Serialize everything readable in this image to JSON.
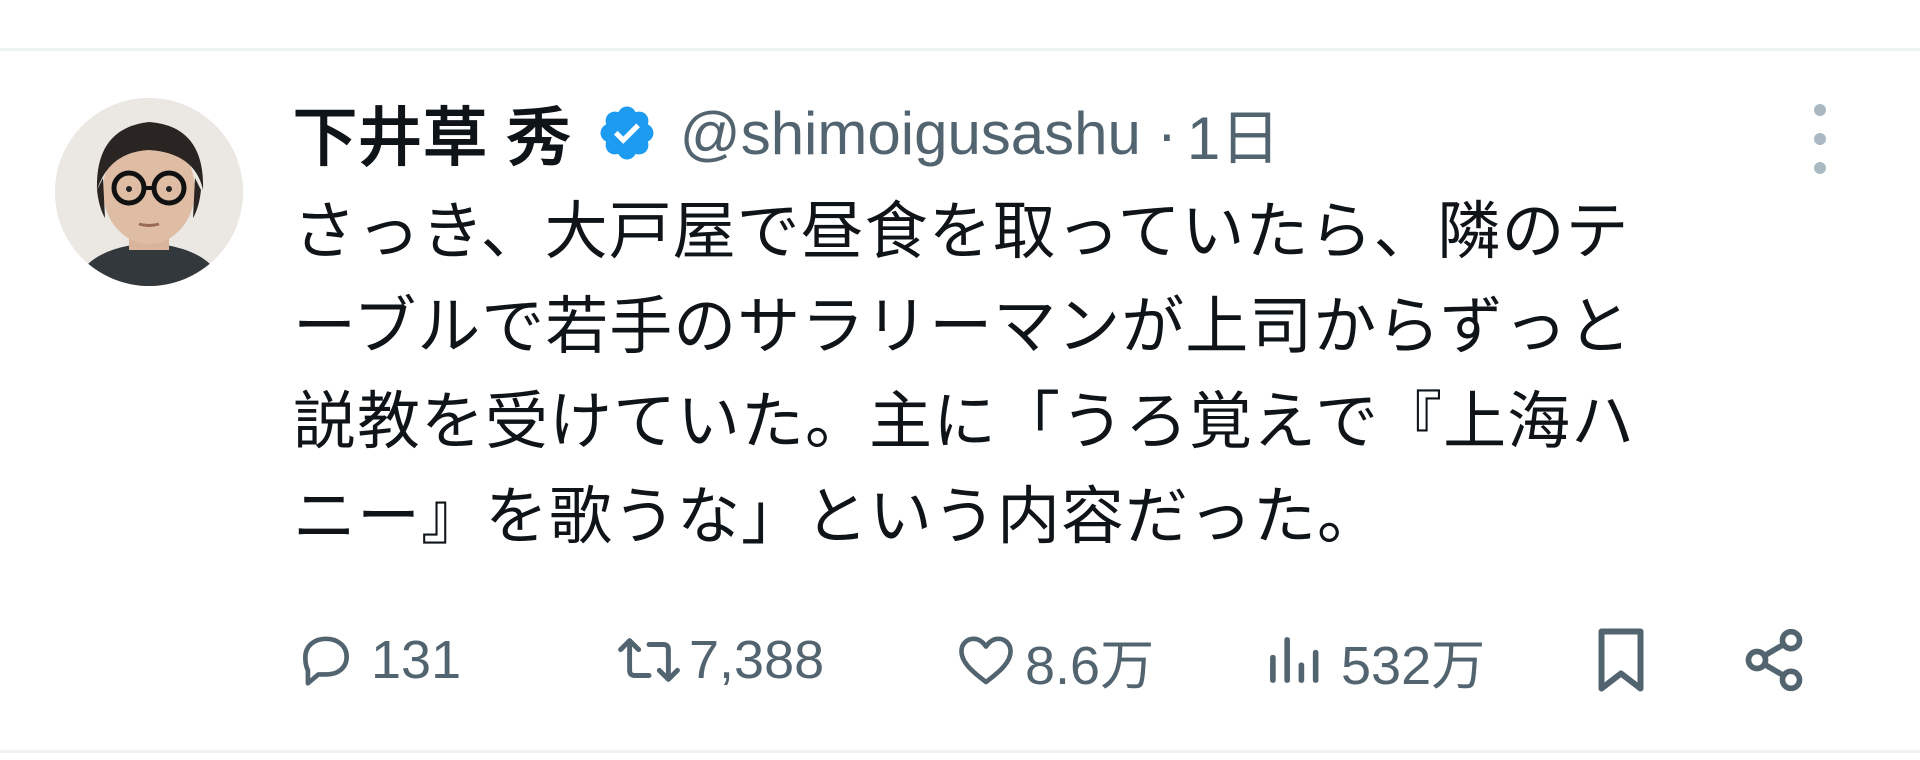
{
  "tweet": {
    "author": {
      "display_name": "下井草 秀",
      "handle": "@shimoigusashu",
      "verified": true
    },
    "separator": "·",
    "time": "1日",
    "text_lines": [
      "さっき、大戸屋で昼食を取っていたら、隣のテ",
      "ーブルで若手のサラリーマンが上司からずっと",
      "説教を受けていた。主に「うろ覚えで『上海ハ",
      "ニー』を歌うな」という内容だった。"
    ],
    "stats": {
      "replies": "131",
      "retweets": "7,388",
      "likes": "8.6万",
      "views": "532万"
    }
  },
  "icons": {
    "verified": "verified-badge-icon",
    "more": "more-vertical-icon",
    "reply": "reply-icon",
    "retweet": "retweet-icon",
    "like": "heart-icon",
    "views": "views-bar-chart-icon",
    "bookmark": "bookmark-icon",
    "share": "share-icon"
  },
  "colors": {
    "accent": "#1d9bf0",
    "text": "#0f1419",
    "muted": "#536471",
    "divider": "#eff3f4"
  }
}
